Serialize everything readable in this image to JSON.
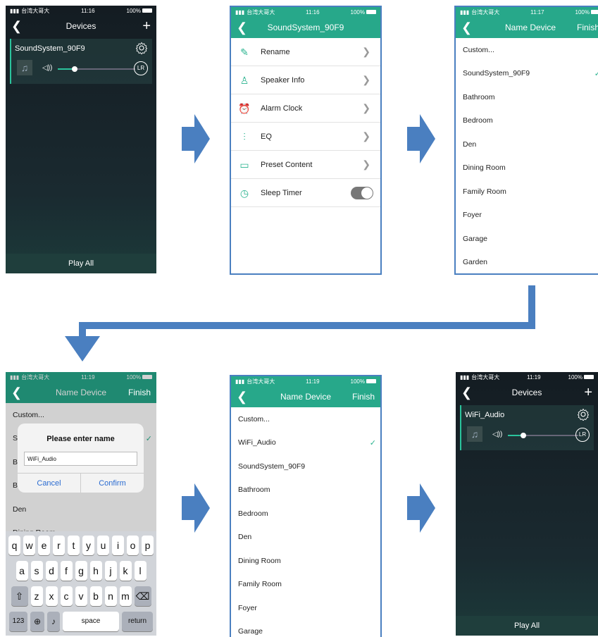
{
  "status": {
    "carrier": "台湾大哥大",
    "battery": "100%"
  },
  "screen1": {
    "time": "11:16",
    "title": "Devices",
    "add": "+",
    "device_name": "SoundSystem_90F9",
    "lr": "LR",
    "play_all": "Play All",
    "volume": 0.2
  },
  "screen2": {
    "time": "11:16",
    "title": "SoundSystem_90F9",
    "items": [
      {
        "label": "Rename",
        "icon": "edit-icon"
      },
      {
        "label": "Speaker Info",
        "icon": "person-icon"
      },
      {
        "label": "Alarm Clock",
        "icon": "alarm-icon"
      },
      {
        "label": "EQ",
        "icon": "equalizer-icon"
      },
      {
        "label": "Preset Content",
        "icon": "preset-icon"
      },
      {
        "label": "Sleep Timer",
        "icon": "timer-icon"
      }
    ]
  },
  "screen3": {
    "time": "11:17",
    "title": "Name Device",
    "finish": "Finish",
    "items": [
      "Custom...",
      "SoundSystem_90F9",
      "Bathroom",
      "Bedroom",
      "Den",
      "Dining Room",
      "Family Room",
      "Foyer",
      "Garage",
      "Garden"
    ]
  },
  "screen4": {
    "time": "11:19",
    "title": "Name Device",
    "finish": "Finish",
    "items": [
      "Custom...",
      "S",
      "B",
      "B",
      "Den",
      "Dining Room"
    ],
    "dialog_title": "Please enter name",
    "input_value": "WiFi_Audio",
    "cancel": "Cancel",
    "confirm": "Confirm",
    "kb_row1": [
      "q",
      "w",
      "e",
      "r",
      "t",
      "y",
      "u",
      "i",
      "o",
      "p"
    ],
    "kb_row2": [
      "a",
      "s",
      "d",
      "f",
      "g",
      "h",
      "j",
      "k",
      "l"
    ],
    "kb_row3": [
      "z",
      "x",
      "c",
      "v",
      "b",
      "n",
      "m"
    ],
    "kb_123": "123",
    "kb_space": "space",
    "kb_return": "return"
  },
  "screen5": {
    "time": "11:19",
    "title": "Name Device",
    "finish": "Finish",
    "items": [
      "Custom...",
      "WiFi_Audio",
      "SoundSystem_90F9",
      "Bathroom",
      "Bedroom",
      "Den",
      "Dining Room",
      "Family Room",
      "Foyer",
      "Garage"
    ]
  },
  "screen6": {
    "time": "11:19",
    "title": "Devices",
    "add": "+",
    "device_name": "WiFi_Audio",
    "lr": "LR",
    "play_all": "Play All",
    "volume": 0.2
  },
  "colors": {
    "accent": "#2ab38f",
    "arrow": "#4a7fc0"
  }
}
